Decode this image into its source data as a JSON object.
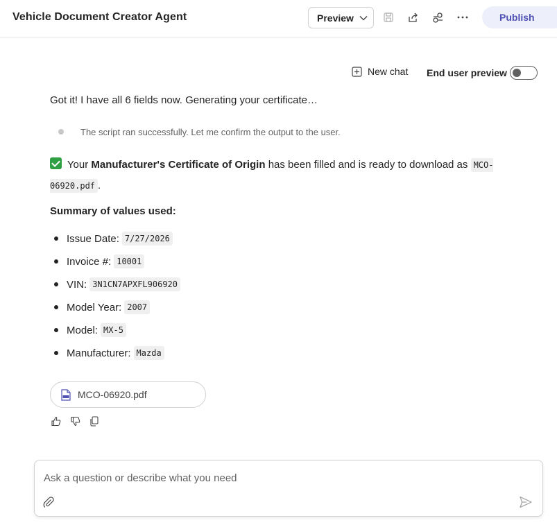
{
  "header": {
    "title": "Vehicle Document Creator Agent",
    "preview_label": "Preview",
    "publish_label": "Publish"
  },
  "chat_toolbar": {
    "new_chat_label": "New chat",
    "end_user_preview_label": "End user preview",
    "end_user_preview_on": false
  },
  "messages": {
    "intro": "Got it! I have all 6 fields now. Generating your certificate…",
    "step": "The script ran successfully. Let me confirm the output to the user.",
    "result_prefix": "Your",
    "result_bold": "Manufacturer's Certificate of Origin",
    "result_middle": "has been filled and is ready to download as",
    "result_filename": "MCO-06920.pdf",
    "result_suffix": ".",
    "summary_heading": "Summary of values used:",
    "summary": [
      {
        "label": "Issue Date:",
        "value": "7/27/2026"
      },
      {
        "label": "Invoice #:",
        "value": "10001"
      },
      {
        "label": "VIN:",
        "value": "3N1CN7APXFL906920"
      },
      {
        "label": "Model Year:",
        "value": "2007"
      },
      {
        "label": "Model:",
        "value": "MX-5"
      },
      {
        "label": "Manufacturer:",
        "value": "Mazda"
      }
    ]
  },
  "attachment": {
    "filename": "MCO-06920.pdf"
  },
  "composer": {
    "placeholder": "Ask a question or describe what you need"
  }
}
